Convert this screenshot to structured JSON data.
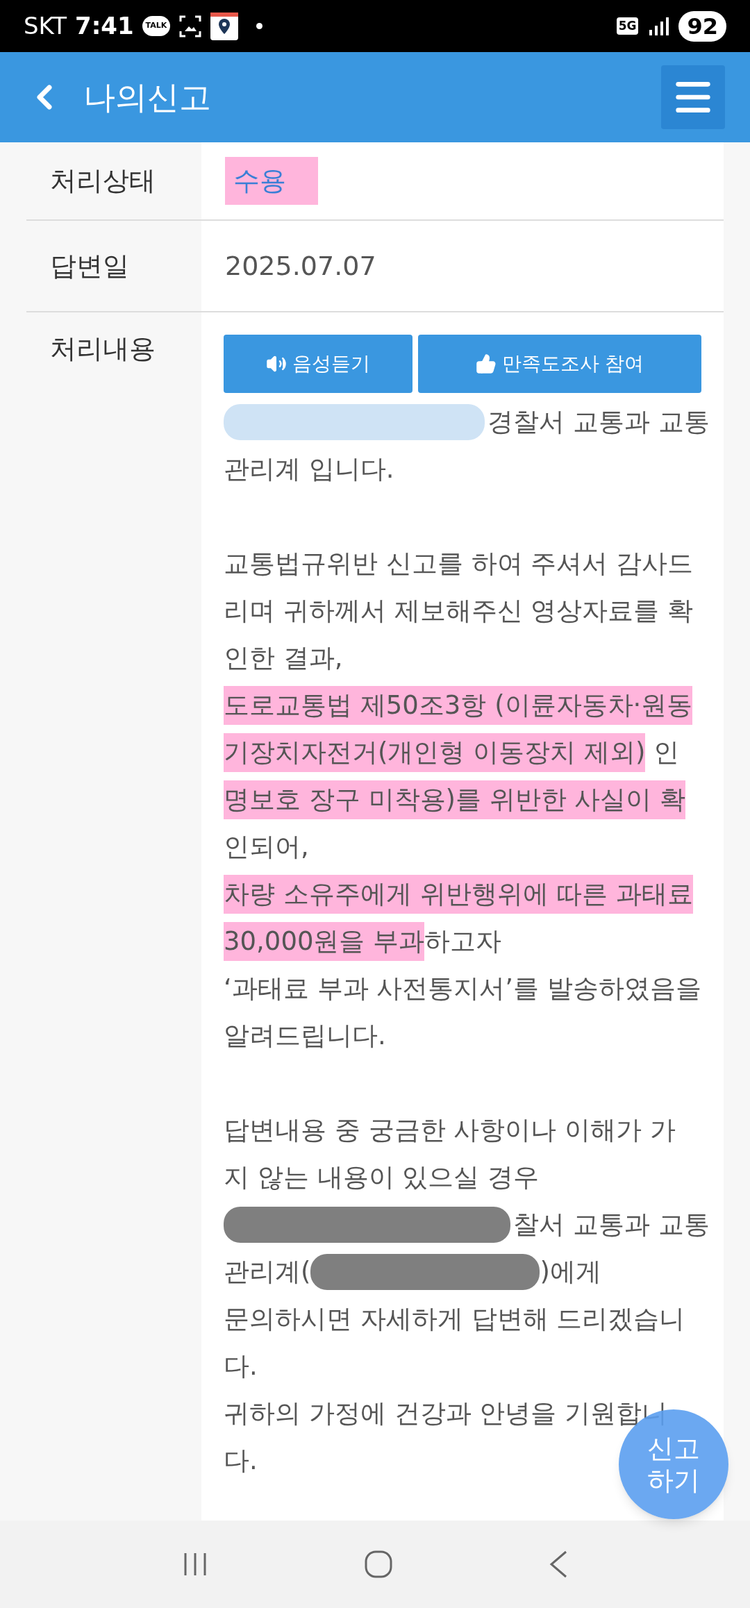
{
  "status_bar": {
    "carrier": "SKT",
    "time": "7:41",
    "talk": "TALK",
    "network": "5G",
    "battery": "92"
  },
  "header": {
    "title": "나의신고"
  },
  "details": [
    {
      "label": "처리상태",
      "kind": "status",
      "value": "수용",
      "highlighted": true
    },
    {
      "label": "답변일",
      "kind": "date",
      "value": "2025.07.07",
      "highlighted": false
    }
  ],
  "content": {
    "label": "처리내용",
    "buttons": [
      {
        "label": "음성듣기"
      },
      {
        "label": "만족도조사 참여"
      }
    ],
    "paragraphs": [
      {
        "lines": [
          [
            {
              "kind": "redacted",
              "color": "#cfe3f5"
            },
            {
              "kind": "text",
              "text": "경찰서 교통과 교통",
              "highlighted": false
            }
          ],
          [
            {
              "kind": "text",
              "text": "관리계 입니다.",
              "highlighted": false
            }
          ]
        ]
      },
      {
        "lines": [
          [
            {
              "kind": "text",
              "text": "교통법규위반 신고를 하여 주셔서 감사드",
              "highlighted": false
            }
          ],
          [
            {
              "kind": "text",
              "text": "리며 귀하께서 제보해주신 영상자료를 확",
              "highlighted": false
            }
          ],
          [
            {
              "kind": "text",
              "text": "인한 결과,",
              "highlighted": false
            }
          ],
          [
            {
              "kind": "text",
              "text": "도로교통법 제50조3항 (이륜자동차·원동",
              "highlighted": true
            }
          ],
          [
            {
              "kind": "text",
              "text": "기장치자전거(개인형 이동장치 제외)",
              "highlighted": true
            },
            {
              "kind": "text",
              "text": " 인",
              "highlighted": false
            }
          ],
          [
            {
              "kind": "text",
              "text": "명보호 장구 미착용)를 위반한 사실이 확",
              "highlighted": true
            }
          ],
          [
            {
              "kind": "text",
              "text": "인되어,",
              "highlighted": false
            }
          ],
          [
            {
              "kind": "text",
              "text": "차량 소유주에게 위반행위에 따른 과태료",
              "highlighted": true
            }
          ],
          [
            {
              "kind": "text",
              "text": "30,000원을 부과",
              "highlighted": true
            },
            {
              "kind": "text",
              "text": "하고자",
              "highlighted": false
            }
          ],
          [
            {
              "kind": "text",
              "text": "‘과태료 부과 사전통지서’를 발송하였음을",
              "highlighted": false
            }
          ],
          [
            {
              "kind": "text",
              "text": "알려드립니다.",
              "highlighted": false
            }
          ]
        ]
      },
      {
        "lines": [
          [
            {
              "kind": "text",
              "text": "답변내용 중 궁금한 사항이나 이해가 가",
              "highlighted": false
            }
          ],
          [
            {
              "kind": "text",
              "text": "지 않는 내용이 있으실 경우",
              "highlighted": false
            }
          ],
          [
            {
              "kind": "redacted",
              "color": "#7f7f7f"
            },
            {
              "kind": "text",
              "text": "찰서 교통과 교통",
              "highlighted": false
            }
          ],
          [
            {
              "kind": "text",
              "text": "관리계(",
              "highlighted": false
            },
            {
              "kind": "redacted",
              "color": "#7f7f7f"
            },
            {
              "kind": "text",
              "text": ")에게",
              "highlighted": false
            }
          ],
          [
            {
              "kind": "text",
              "text": "문의하시면 자세하게 답변해 드리겠습니",
              "highlighted": false
            }
          ],
          [
            {
              "kind": "text",
              "text": "다.",
              "highlighted": false
            }
          ],
          [
            {
              "kind": "text",
              "text": "귀하의 가정에 건강과 안녕을 기원합니",
              "highlighted": false
            }
          ],
          [
            {
              "kind": "text",
              "text": "다.",
              "highlighted": false
            }
          ]
        ]
      }
    ]
  },
  "fab": {
    "line1": "신고",
    "line2": "하기"
  }
}
